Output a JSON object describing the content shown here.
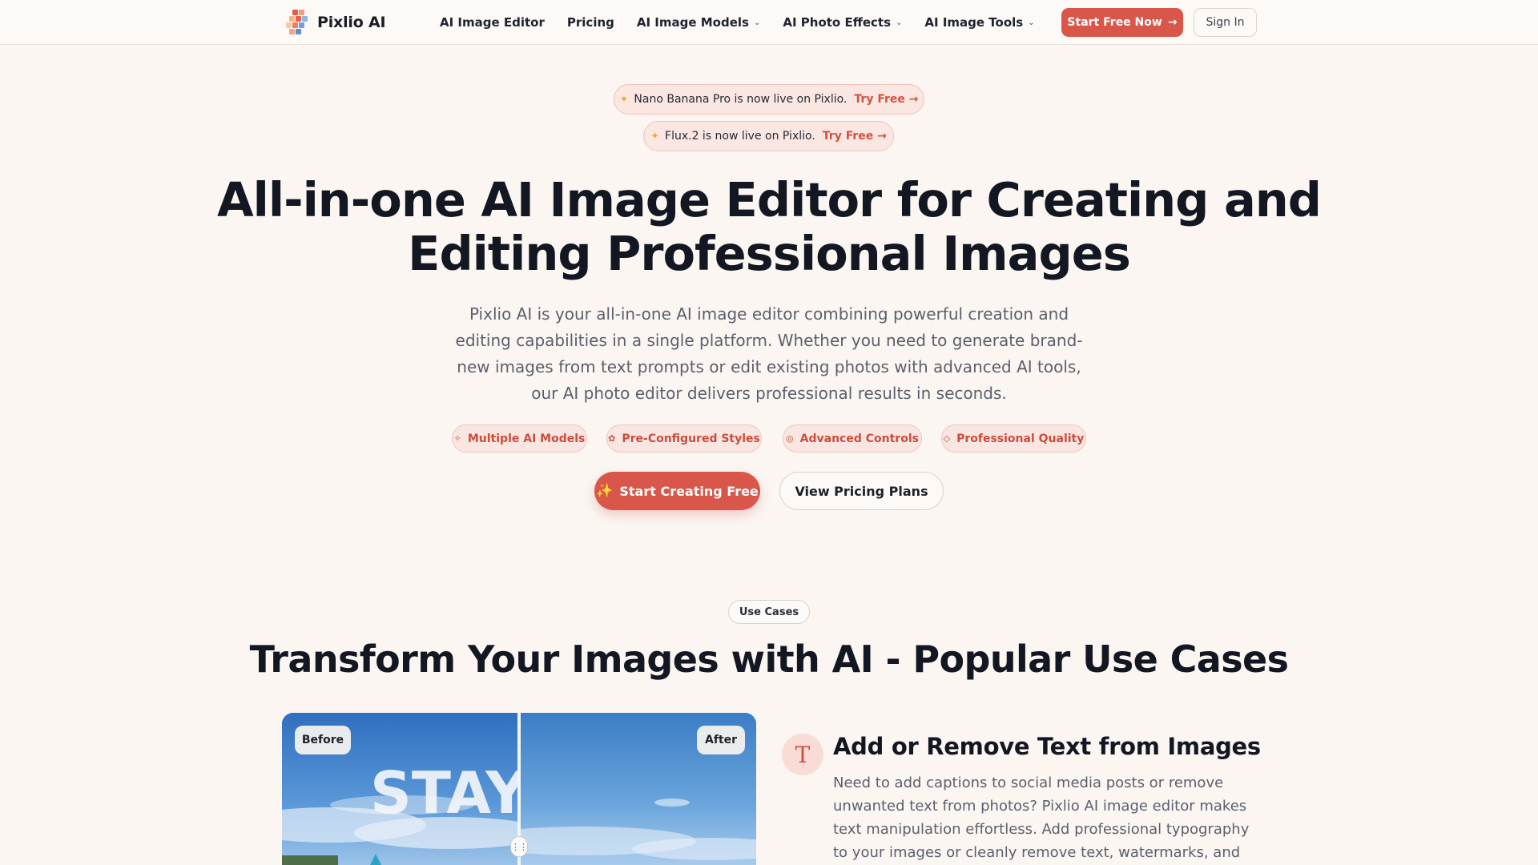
{
  "brand": {
    "name": "Pixlio AI"
  },
  "nav": {
    "links": [
      {
        "label": "AI Image Editor",
        "has_dropdown": false
      },
      {
        "label": "Pricing",
        "has_dropdown": false
      },
      {
        "label": "AI Image Models",
        "has_dropdown": true
      },
      {
        "label": "AI Photo Effects",
        "has_dropdown": true
      },
      {
        "label": "AI Image Tools",
        "has_dropdown": true
      }
    ],
    "cta_label": "Start Free Now",
    "signin_label": "Sign In"
  },
  "announcements": [
    {
      "text": "Nano Banana Pro is now live on Pixlio.",
      "link_label": "Try Free"
    },
    {
      "text": "Flux.2 is now live on Pixlio.",
      "link_label": "Try Free"
    }
  ],
  "hero": {
    "title_line1": "All-in-one AI Image Editor for Creating and",
    "title_line2": "Editing Professional Images",
    "description": "Pixlio AI is your all-in-one AI image editor combining powerful creation and editing capabilities in a single platform. Whether you need to generate brand-new images from text prompts or edit existing photos with advanced AI tools, our AI photo editor delivers professional results in seconds.",
    "tags": [
      {
        "label": "Multiple AI Models",
        "icon": "sparkle-icon"
      },
      {
        "label": "Pre-Configured Styles",
        "icon": "palette-icon"
      },
      {
        "label": "Advanced Controls",
        "icon": "target-icon"
      },
      {
        "label": "Professional Quality",
        "icon": "gem-icon"
      }
    ],
    "primary_cta": "Start Creating Free",
    "secondary_cta": "View Pricing Plans"
  },
  "use_cases": {
    "badge": "Use Cases",
    "title": "Transform Your Images with AI - Popular Use Cases",
    "items": [
      {
        "before_label": "Before",
        "after_label": "After",
        "image_text": "STAY",
        "icon": "text-icon",
        "title": "Add or Remove Text from Images",
        "description": "Need to add captions to social media posts or remove unwanted text from photos? Pixlio AI image editor makes text manipulation effortless. Add professional typography to your images or cleanly remove text, watermarks, and"
      }
    ]
  },
  "colors": {
    "accent": "#d8574a",
    "background": "#fbf6f2",
    "tag_background": "#fae6e1",
    "heading": "#121722",
    "body_text": "#5a5f6c"
  }
}
